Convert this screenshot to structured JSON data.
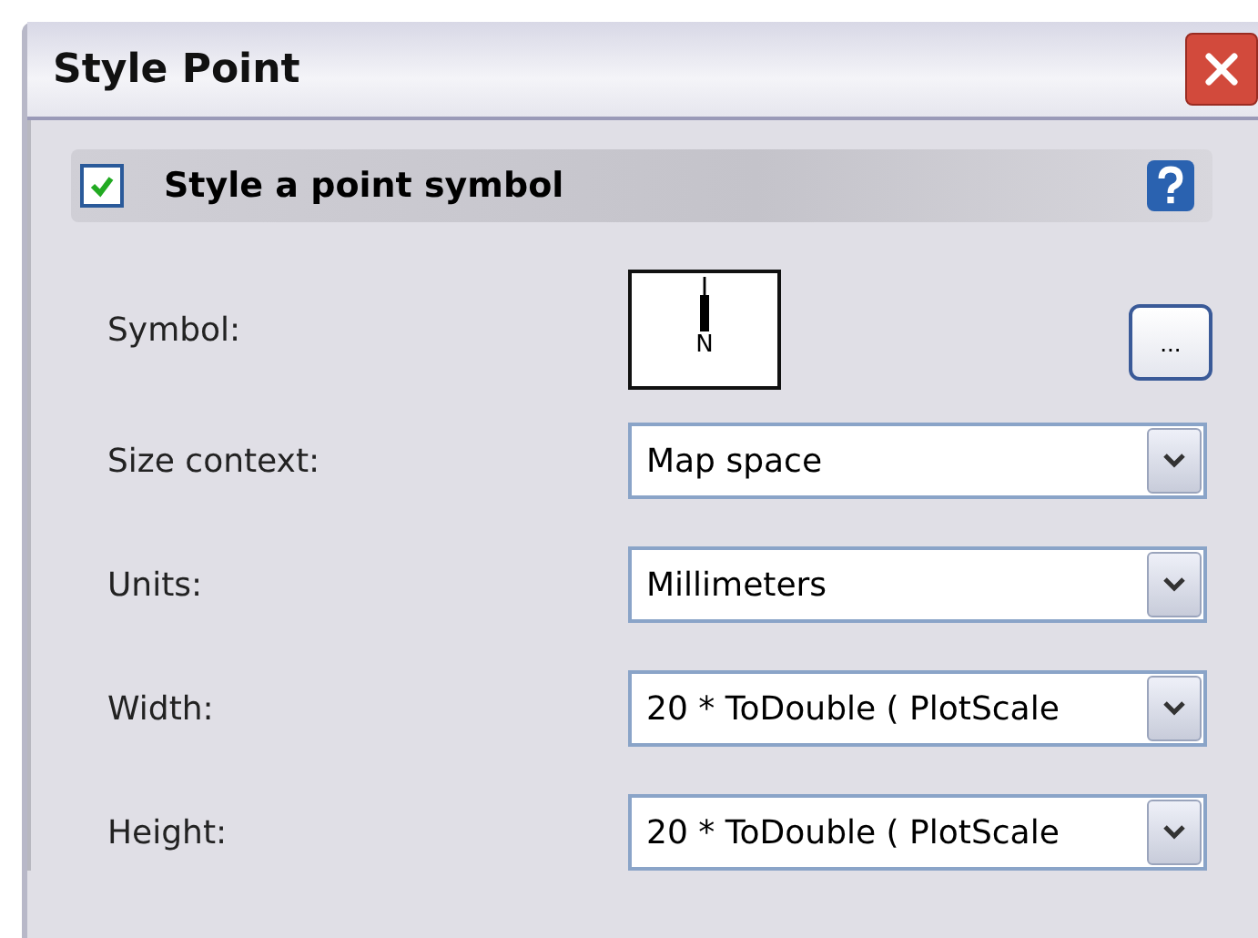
{
  "window": {
    "title": "Style Point"
  },
  "header": {
    "label": "Style a point symbol",
    "checked": true
  },
  "symbol": {
    "label": "Symbol:",
    "preview_text": "N",
    "browse_button": "..."
  },
  "fields": [
    {
      "label": "Size context:",
      "value": "Map space"
    },
    {
      "label": "Units:",
      "value": "Millimeters"
    },
    {
      "label": "Width:",
      "value": "20 *  ToDouble (  PlotScale"
    },
    {
      "label": "Height:",
      "value": "20 *  ToDouble (  PlotScale"
    }
  ]
}
